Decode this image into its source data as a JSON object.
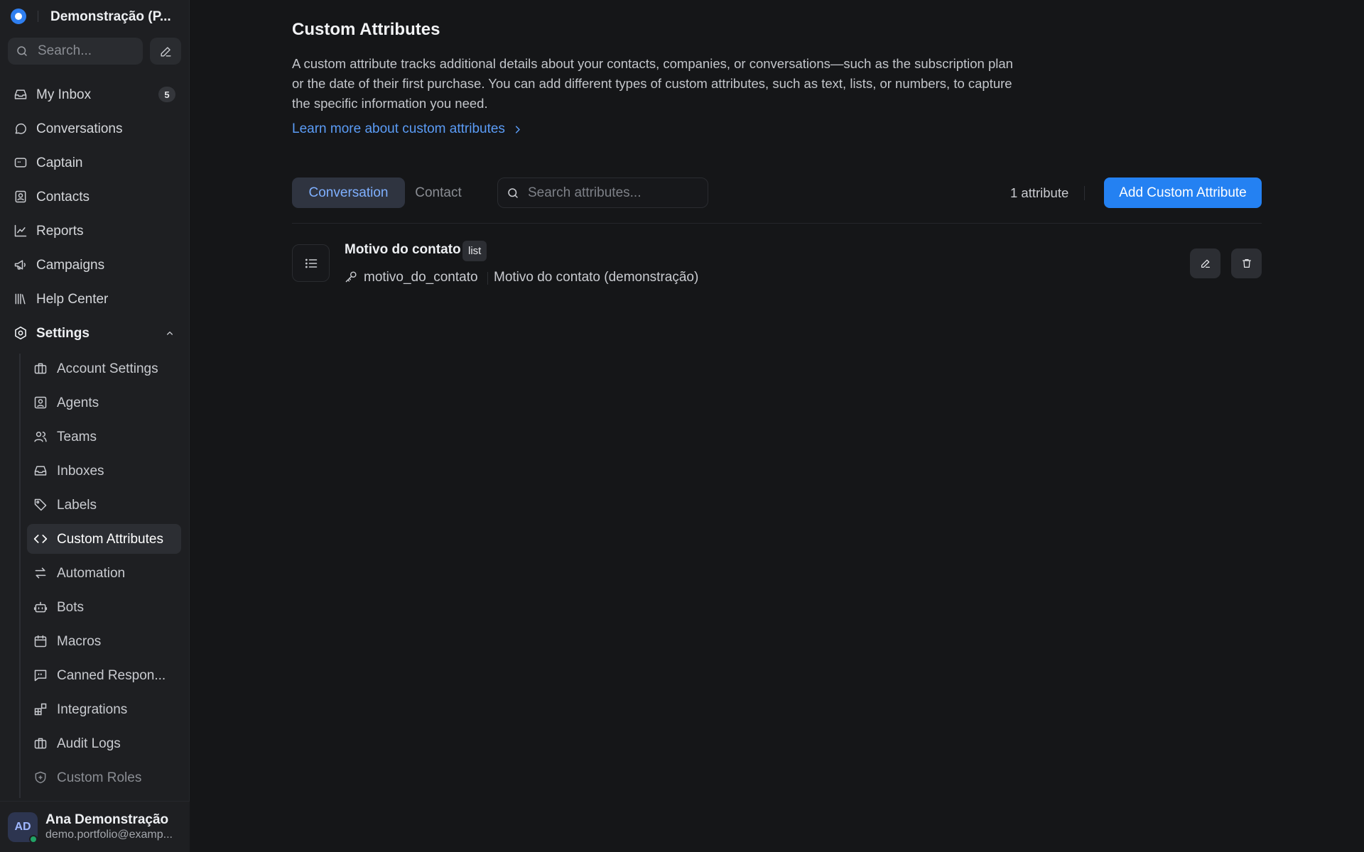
{
  "account": {
    "name": "Demonstração (P..."
  },
  "sidebar": {
    "search_placeholder": "Search...",
    "nav": [
      {
        "label": "My Inbox",
        "icon": "inbox-icon",
        "badge": "5"
      },
      {
        "label": "Conversations",
        "icon": "chat-bubble-icon"
      },
      {
        "label": "Captain",
        "icon": "captain-icon"
      },
      {
        "label": "Contacts",
        "icon": "contact-card-icon"
      },
      {
        "label": "Reports",
        "icon": "line-chart-icon"
      },
      {
        "label": "Campaigns",
        "icon": "megaphone-icon"
      },
      {
        "label": "Help Center",
        "icon": "library-icon"
      }
    ],
    "settings": {
      "label": "Settings",
      "icon": "settings-icon",
      "expanded": true
    },
    "settings_items": [
      {
        "label": "Account Settings",
        "icon": "briefcase-icon"
      },
      {
        "label": "Agents",
        "icon": "user-square-icon"
      },
      {
        "label": "Teams",
        "icon": "users-icon"
      },
      {
        "label": "Inboxes",
        "icon": "inbox-icon"
      },
      {
        "label": "Labels",
        "icon": "tag-icon"
      },
      {
        "label": "Custom Attributes",
        "icon": "code-icon",
        "active": true
      },
      {
        "label": "Automation",
        "icon": "arrows-swap-icon"
      },
      {
        "label": "Bots",
        "icon": "bot-icon"
      },
      {
        "label": "Macros",
        "icon": "calendar-icon"
      },
      {
        "label": "Canned Respon...",
        "icon": "message-quote-icon"
      },
      {
        "label": "Integrations",
        "icon": "blocks-icon"
      },
      {
        "label": "Audit Logs",
        "icon": "briefcase-icon"
      },
      {
        "label": "Custom Roles",
        "icon": "shield-icon"
      }
    ]
  },
  "user": {
    "initials": "AD",
    "name": "Ana Demonstração",
    "email": "demo.portfolio@examp...",
    "status_color": "#21a366"
  },
  "page": {
    "title": "Custom Attributes",
    "description": "A custom attribute tracks additional details about your contacts, companies, or conversations—such as the subscription plan or the date of their first purchase. You can add different types of custom attributes, such as text, lists, or numbers, to capture the specific information you need.",
    "learn_more": "Learn more about custom attributes"
  },
  "tabs": [
    {
      "label": "Conversation",
      "active": true
    },
    {
      "label": "Contact",
      "active": false
    }
  ],
  "attr_search_placeholder": "Search attributes...",
  "attribute_count": "1 attribute",
  "add_button": "Add Custom Attribute",
  "attributes": [
    {
      "name": "Motivo do contato",
      "type": "list",
      "key": "motivo_do_contato",
      "description": "Motivo do contato (demonstração)"
    }
  ],
  "colors": {
    "accent": "#2481f2",
    "link": "#5b9cf6",
    "background": "#151618",
    "sidebar": "#1e1f22"
  }
}
